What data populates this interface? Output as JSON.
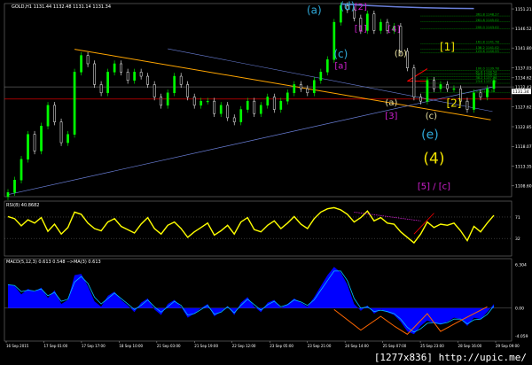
{
  "window": {
    "instrument_header": "GOLD,H1  1131.44 1132.48 1131.14 1131.34"
  },
  "watermark": "[1277x836]  http://upic.me/",
  "colors": {
    "background": "#000000",
    "candle_bull": "#00ff00",
    "candle_bear": "#ffffff",
    "rsi_line": "#ffff00",
    "macd_hist": "#0000ff",
    "macd_signal": "#00bfff",
    "trend_orange": "#ffa500",
    "trend_blue": "#6a7fd8",
    "red_level": "#ff0000",
    "fib_green": "#00c000",
    "label_cyan": "#2fa8d8",
    "label_magenta": "#d020d0",
    "label_yellow": "#f2e200",
    "label_beige": "#e8e0a0"
  },
  "chart_data": [
    {
      "type": "line",
      "name": "price",
      "title": "GOLD,H1",
      "yticks": [
        1151.21,
        1146.52,
        1141.8,
        1137.03,
        1134.62,
        1132.43,
        1127.62,
        1122.85,
        1118.07,
        1113.35,
        1108.6
      ],
      "ylim": [
        1106.0,
        1152.5
      ],
      "last_price": "1131.34",
      "series": [
        {
          "values": [
            1107,
            1110,
            1115,
            1121,
            1117,
            1123,
            1128,
            1124,
            1119,
            1121,
            1136,
            1140,
            1138,
            1133,
            1131,
            1136,
            1138,
            1136,
            1134,
            1136,
            1135,
            1133,
            1130,
            1128,
            1131,
            1135,
            1133,
            1130,
            1128,
            1129,
            1129,
            1126,
            1128,
            1125,
            1124,
            1127,
            1129,
            1126,
            1128,
            1130,
            1127,
            1129,
            1131,
            1133,
            1132,
            1131,
            1134,
            1136,
            1139,
            1148,
            1152,
            1151,
            1149,
            1146,
            1150,
            1146,
            1148,
            1146,
            1147,
            1141,
            1137,
            1130,
            1129,
            1134,
            1132,
            1133,
            1132,
            1132,
            1129,
            1127,
            1131,
            1130,
            1132,
            1134
          ]
        }
      ],
      "trendlines": [
        {
          "name": "orange-trendline",
          "color": "#ffa500"
        },
        {
          "name": "blue-channel-upper",
          "color": "#6a7fd8"
        },
        {
          "name": "blue-channel-lower",
          "color": "#6a7fd8"
        },
        {
          "name": "blue-arc",
          "color": "#6a7fd8"
        }
      ],
      "fib_levels": [
        {
          "label": "361.8 1148.27",
          "value": 1149.5
        },
        {
          "label": "261.8 1145.02",
          "value": 1148.1
        },
        {
          "label": "200.0 1143.02",
          "value": 1146.4
        },
        {
          "label": "161.8 1141.78",
          "value": 1142.8
        },
        {
          "label": "138.2 1141.02",
          "value": 1141.5
        },
        {
          "label": "123.6 1140.55",
          "value": 1140.6
        },
        {
          "label": "100.0 1139.78",
          "value": 1136.4
        },
        {
          "label": "61.8 1138.54",
          "value": 1135.6
        },
        {
          "label": "50.0 1138.16",
          "value": 1134.9
        },
        {
          "label": "38.2 1137.78",
          "value": 1134.2
        },
        {
          "label": "23.6 1137.30",
          "value": 1133.3
        },
        {
          "label": "0.0 1136.54",
          "value": 1131.0
        }
      ],
      "red_level": 1129.5,
      "gray_level": 1132.43,
      "wave_labels": [
        {
          "text": "(a)",
          "color": "#2fa8d8",
          "x": 46,
          "y": 1150,
          "size": 12
        },
        {
          "text": "(d)",
          "color": "#2fa8d8",
          "x": 51,
          "y": 1151,
          "size": 12
        },
        {
          "text": "[2]",
          "color": "#d020d0",
          "x": 53,
          "y": 1151,
          "size": 10
        },
        {
          "text": "[1]",
          "color": "#d020d0",
          "x": 53,
          "y": 1145.8,
          "size": 10
        },
        {
          "text": "[4]",
          "color": "#d020d0",
          "x": 58,
          "y": 1145.7,
          "size": 10
        },
        {
          "text": "(c)",
          "color": "#2fa8d8",
          "x": 50,
          "y": 1139.5,
          "size": 12
        },
        {
          "text": "[a]",
          "color": "#d020d0",
          "x": 50,
          "y": 1136.8,
          "size": 10
        },
        {
          "text": "(b)",
          "color": "#e8e0a0",
          "x": 59,
          "y": 1139.8,
          "size": 10
        },
        {
          "text": "[1]",
          "color": "#f2e200",
          "x": 66,
          "y": 1141.2,
          "size": 12
        },
        {
          "text": "(a)",
          "color": "#e8e0a0",
          "x": 57.6,
          "y": 1128,
          "size": 10
        },
        {
          "text": "[2]",
          "color": "#f2e200",
          "x": 67,
          "y": 1127.6,
          "size": 12
        },
        {
          "text": "[3]",
          "color": "#d020d0",
          "x": 57.6,
          "y": 1124.8,
          "size": 10
        },
        {
          "text": "(c)",
          "color": "#e8e0a0",
          "x": 63.6,
          "y": 1124.8,
          "size": 10
        },
        {
          "text": "(e)",
          "color": "#2fa8d8",
          "x": 63.4,
          "y": 1120,
          "size": 14
        },
        {
          "text": "(4)",
          "color": "#f2e200",
          "x": 64,
          "y": 1114,
          "size": 17
        },
        {
          "text": "[5] / [c]",
          "color": "#d020d0",
          "x": 64,
          "y": 1107.8,
          "size": 10
        }
      ]
    },
    {
      "type": "line",
      "name": "rsi",
      "title": "RSI(8) 40.8682",
      "yticks": [
        71,
        32
      ],
      "ylim": [
        0,
        100
      ],
      "series": [
        {
          "values": [
            72,
            68,
            55,
            66,
            60,
            70,
            45,
            58,
            40,
            52,
            80,
            76,
            60,
            50,
            46,
            62,
            68,
            54,
            48,
            42,
            58,
            70,
            50,
            40,
            56,
            62,
            50,
            34,
            44,
            52,
            60,
            38,
            46,
            56,
            40,
            62,
            70,
            48,
            44,
            56,
            64,
            50,
            60,
            72,
            58,
            50,
            68,
            80,
            86,
            88,
            84,
            76,
            62,
            70,
            82,
            64,
            70,
            60,
            58,
            44,
            34,
            24,
            40,
            62,
            52,
            58,
            56,
            60,
            46,
            28,
            54,
            44,
            60,
            74
          ]
        }
      ],
      "annotations": [
        {
          "name": "rsi-divergence-line",
          "color": "#d020d0"
        },
        {
          "name": "rsi-trend-line",
          "color": "#ff0000"
        }
      ]
    },
    {
      "type": "area",
      "name": "macd",
      "title": "MACD(5,12,3) 0.613 0.548 -->MA(3) 0.613",
      "yticks": [
        6.304,
        0.0,
        -4.059
      ],
      "ylim": [
        -4.8,
        7.2
      ],
      "series": [
        {
          "name": "macd-histogram",
          "values": [
            3.5,
            3.2,
            2.0,
            2.8,
            2.4,
            3.0,
            1.5,
            2.6,
            0.6,
            1.2,
            4.8,
            5.0,
            3.2,
            1.0,
            0.2,
            1.8,
            2.4,
            1.2,
            0.4,
            -0.6,
            0.8,
            1.4,
            -0.2,
            -1.0,
            0.6,
            1.2,
            0.2,
            -1.4,
            -0.8,
            0.0,
            0.6,
            -1.2,
            -0.5,
            0.3,
            -1.0,
            0.8,
            1.6,
            0.2,
            -0.6,
            0.8,
            1.2,
            0.0,
            0.6,
            1.4,
            0.8,
            0.2,
            1.6,
            3.2,
            4.8,
            6.0,
            5.2,
            3.4,
            0.6,
            -0.4,
            0.4,
            -0.8,
            -0.2,
            -0.6,
            -1.0,
            -2.0,
            -3.4,
            -3.8,
            -2.6,
            -1.8,
            -2.2,
            -2.4,
            -2.0,
            -1.4,
            -1.6,
            -2.6,
            -1.4,
            -1.6,
            -0.6,
            0.6
          ]
        },
        {
          "name": "macd-signal",
          "values": [
            3.4,
            3.3,
            2.4,
            2.6,
            2.5,
            2.8,
            1.8,
            2.3,
            1.0,
            1.3,
            3.8,
            4.6,
            3.6,
            1.6,
            0.6,
            1.4,
            2.2,
            1.4,
            0.6,
            -0.2,
            0.4,
            1.2,
            0.2,
            -0.6,
            0.2,
            1.0,
            0.4,
            -1.0,
            -0.8,
            -0.2,
            0.4,
            -0.9,
            -0.6,
            0.2,
            -0.7,
            0.4,
            1.3,
            0.5,
            -0.3,
            0.5,
            1.0,
            0.2,
            0.5,
            1.2,
            0.9,
            0.4,
            1.2,
            2.6,
            4.0,
            5.4,
            5.4,
            4.0,
            1.4,
            0.0,
            0.2,
            -0.5,
            -0.3,
            -0.5,
            -0.8,
            -1.6,
            -2.8,
            -3.5,
            -3.0,
            -2.2,
            -2.1,
            -2.3,
            -2.1,
            -1.6,
            -1.6,
            -2.3,
            -1.7,
            -1.6,
            -0.9,
            0.3
          ]
        }
      ],
      "annotations": [
        {
          "name": "macd-zigzag-1",
          "color": "#ff6600"
        },
        {
          "name": "macd-zigzag-2",
          "color": "#ff6600"
        }
      ]
    }
  ],
  "time_axis": [
    "16 Sep 2015",
    "17 Sep 01:00",
    "17 Sep 17:00",
    "18 Sep 10:00",
    "21 Sep 03:00",
    "21 Sep 19:00",
    "22 Sep 12:00",
    "23 Sep 05:00",
    "23 Sep 21:00",
    "24 Sep 14:00",
    "25 Sep 07:00",
    "25 Sep 23:00",
    "28 Sep 16:00",
    "29 Sep 09:00"
  ]
}
